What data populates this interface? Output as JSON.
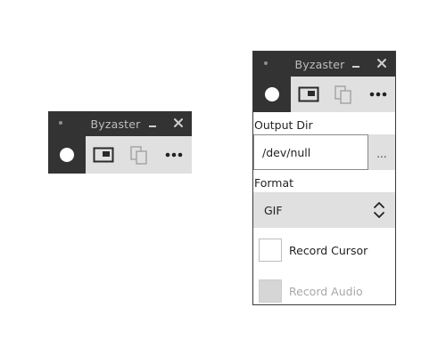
{
  "small_window": {
    "title": "Byzaster",
    "toolbar": {
      "record": "record-circle-icon",
      "window_select": "window-icon",
      "copy": "copy-icon",
      "more": "more-icon"
    }
  },
  "large_window": {
    "title": "Byzaster",
    "toolbar": {
      "record": "record-circle-icon",
      "window_select": "window-icon",
      "copy": "copy-icon",
      "more": "more-icon"
    },
    "output_dir": {
      "label": "Output Dir",
      "value": "/dev/null",
      "browse_label": "..."
    },
    "format": {
      "label": "Format",
      "selected": "GIF"
    },
    "record_cursor": {
      "label": "Record Cursor",
      "checked": false,
      "enabled": true
    },
    "record_audio": {
      "label": "Record Audio",
      "checked": false,
      "enabled": false
    }
  },
  "colors": {
    "titlebar": "#333333",
    "title_text": "#bdbdbd",
    "toolbar": "#e0e0e0",
    "disabled_text": "#a8a8a8"
  }
}
